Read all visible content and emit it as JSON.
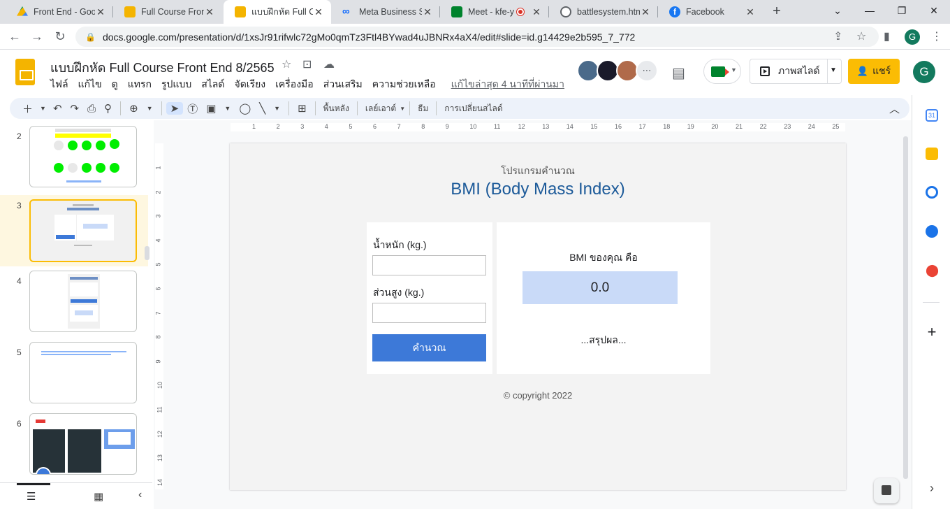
{
  "browser": {
    "tabs": [
      {
        "title": "Front End - Goog",
        "icon": "google-drive-icon",
        "color": "#1a73e8"
      },
      {
        "title": "Full Course Front",
        "icon": "google-slides-icon",
        "color": "#f4b400"
      },
      {
        "title": "แบบฝึกหัด Full Co",
        "icon": "google-slides-icon",
        "color": "#f4b400"
      },
      {
        "title": "Meta Business Su",
        "icon": "meta-icon",
        "color": "#0866ff"
      },
      {
        "title": "Meet - kfe-y",
        "icon": "google-meet-icon",
        "color": "#00832d"
      },
      {
        "title": "battlesystem.htm",
        "icon": "globe-icon",
        "color": "#5f6368"
      },
      {
        "title": "Facebook",
        "icon": "facebook-icon",
        "color": "#1877f2"
      }
    ],
    "new_tab": "+",
    "window_controls": {
      "chevron": "⌄",
      "minimize": "—",
      "restore": "❐",
      "close": "✕"
    },
    "url": "docs.google.com/presentation/d/1xsJr91rifwlc72gMo0qmTz3Ftl4BYwad4uJBNRx4aX4/edit#slide=id.g14429e2b595_7_772",
    "profile_initial": "G"
  },
  "doc": {
    "title": "แบบฝึกหัด Full Course Front End 8/2565",
    "menu": [
      "ไฟล์",
      "แก้ไข",
      "ดู",
      "แทรก",
      "รูปแบบ",
      "สไลด์",
      "จัดเรียง",
      "เครื่องมือ",
      "ส่วนเสริม",
      "ความช่วยเหลือ"
    ],
    "last_edit": "แก้ไขล่าสุด 4 นาทีที่ผ่านมา",
    "present_label": "ภาพสไลด์",
    "share_label": "แชร์",
    "account_initial": "G"
  },
  "toolbar": {
    "background": "พื้นหลัง",
    "layout": "เลย์เอาต์",
    "theme": "ธีม",
    "transition": "การเปลี่ยนสไลด์"
  },
  "filmstrip": {
    "slides": [
      {
        "number": "2"
      },
      {
        "number": "3",
        "selected": true
      },
      {
        "number": "4"
      },
      {
        "number": "5"
      },
      {
        "number": "6"
      }
    ]
  },
  "ruler": {
    "h_ticks": [
      "1",
      "2",
      "3",
      "4",
      "5",
      "6",
      "7",
      "8",
      "9",
      "10",
      "11",
      "12",
      "13",
      "14",
      "15",
      "16",
      "17",
      "18",
      "19",
      "20",
      "21",
      "22",
      "23",
      "24",
      "25"
    ],
    "v_ticks": [
      "1",
      "2",
      "3",
      "4",
      "5",
      "6",
      "7",
      "8",
      "9",
      "10",
      "11",
      "12",
      "13",
      "14"
    ]
  },
  "slide": {
    "subtitle": "โปรแกรมคำนวณ",
    "title": "BMI (Body Mass Index)",
    "weight_label": "น้ำหนัก (kg.)",
    "height_label": "ส่วนสูง (kg.)",
    "calculate_label": "คำนวณ",
    "result_label": "BMI ของคุณ คือ",
    "result_value": "0.0",
    "summary": "...สรุปผล...",
    "copyright": "© copyright 2022",
    "colors": {
      "title": "#1c5a99",
      "button": "#3d79d8",
      "result_bg": "#c9daf8"
    }
  }
}
